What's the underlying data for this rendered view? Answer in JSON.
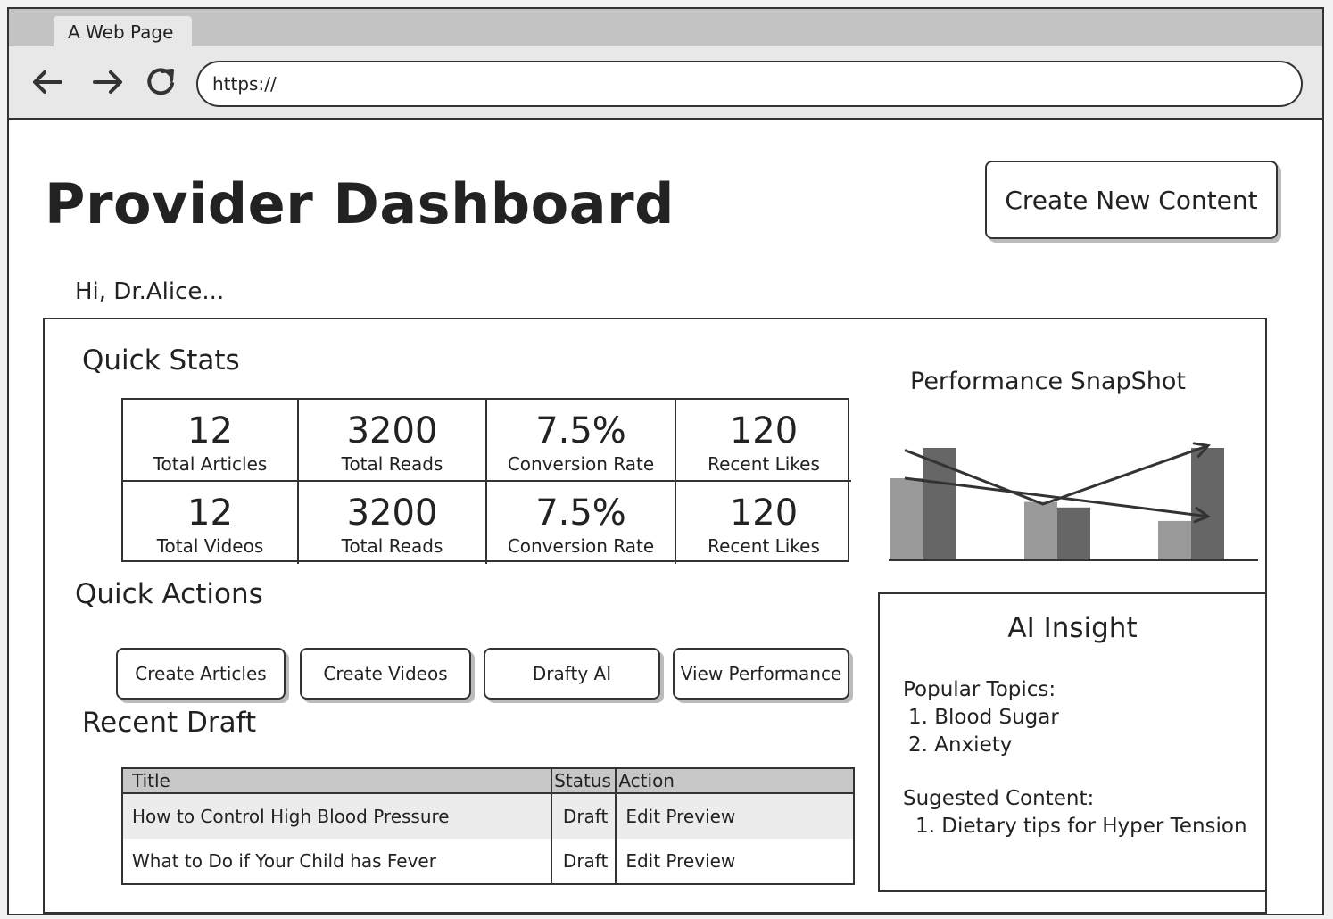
{
  "browser": {
    "tab_title": "A Web Page",
    "url": "https://"
  },
  "header": {
    "title": "Provider Dashboard",
    "create_button": "Create New Content",
    "greeting": "Hi, Dr.Alice..."
  },
  "quick_stats": {
    "title": "Quick Stats",
    "cells": [
      {
        "value": "12",
        "label": "Total Articles"
      },
      {
        "value": "3200",
        "label": "Total Reads"
      },
      {
        "value": "7.5%",
        "label": "Conversion Rate"
      },
      {
        "value": "120",
        "label": "Recent Likes"
      },
      {
        "value": "12",
        "label": "Total Videos"
      },
      {
        "value": "3200",
        "label": "Total Reads"
      },
      {
        "value": "7.5%",
        "label": "Conversion Rate"
      },
      {
        "value": "120",
        "label": "Recent Likes"
      }
    ]
  },
  "quick_actions": {
    "title": "Quick Actions",
    "buttons": [
      "Create Articles",
      "Create Videos",
      "Drafty AI",
      "View Performance"
    ]
  },
  "recent_draft": {
    "title": "Recent Draft",
    "columns": [
      "Title",
      "Status",
      "Action"
    ],
    "rows": [
      {
        "title": "How to Control High Blood Pressure",
        "status": "Draft",
        "action": "Edit Preview"
      },
      {
        "title": "What to Do if Your Child has Fever",
        "status": "Draft",
        "action": "Edit Preview"
      }
    ]
  },
  "performance": {
    "title": "Performance SnapShot"
  },
  "chart_data": {
    "type": "bar",
    "categories": [
      "",
      "",
      ""
    ],
    "series": [
      {
        "values": [
          0.73,
          0.52,
          0.35
        ],
        "color": "#9a9a9a"
      },
      {
        "values": [
          1.0,
          0.47,
          1.0
        ],
        "color": "#666666"
      }
    ],
    "ylim": [
      0,
      1
    ],
    "grid": false,
    "trend_lines": [
      {
        "points": [
          [
            0,
            0.73
          ],
          [
            2,
            0.39
          ]
        ],
        "arrow": true
      },
      {
        "points": [
          [
            0,
            0.98
          ],
          [
            1,
            0.5
          ],
          [
            2,
            1.02
          ]
        ],
        "arrow": true
      }
    ],
    "title": "Performance SnapShot"
  },
  "ai_insight": {
    "title": "AI Insight",
    "popular_heading": "Popular Topics:",
    "popular_topics": [
      "1. Blood Sugar",
      "2. Anxiety"
    ],
    "suggested_heading": "Sugested Content:",
    "suggested": [
      "1. Dietary tips for Hyper Tension"
    ]
  },
  "colors": {
    "border": "#333333",
    "header_fill": "#c3c3c3",
    "bar_light": "#9a9a9a",
    "bar_dark": "#666666"
  },
  "icons": [
    "back-arrow-icon",
    "forward-arrow-icon",
    "reload-icon"
  ]
}
